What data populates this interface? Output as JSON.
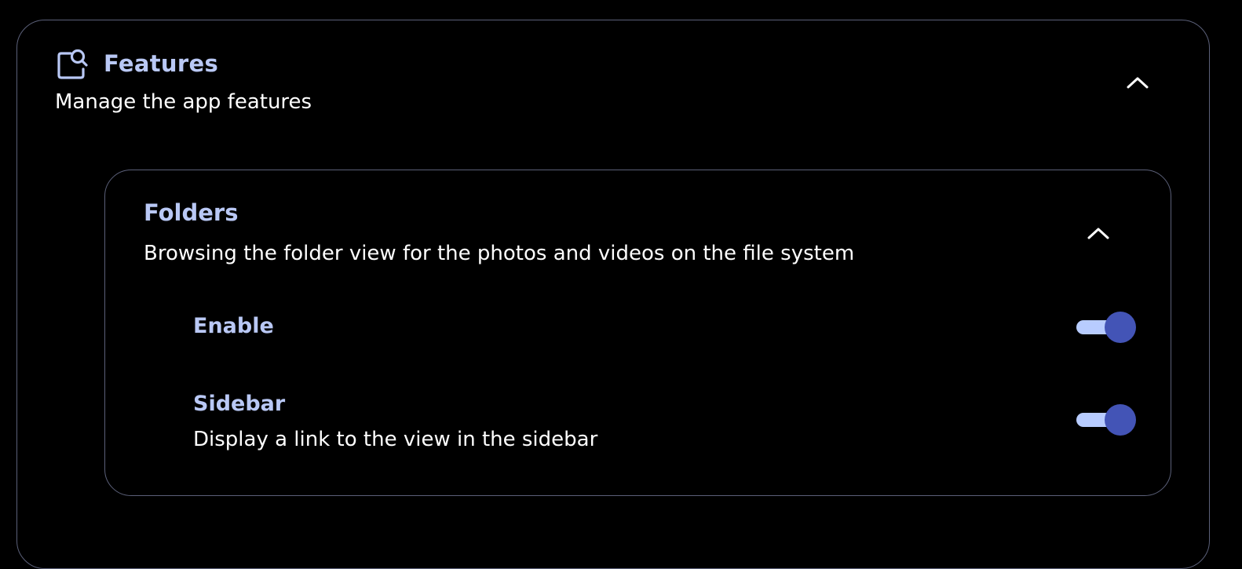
{
  "features": {
    "title": "Features",
    "description": "Manage the app features",
    "icon": "folder-search-icon",
    "expanded": true
  },
  "folders": {
    "title": "Folders",
    "description": "Browsing the folder view for the photos and videos on the file system",
    "expanded": true,
    "settings": [
      {
        "label": "Enable",
        "enabled": true
      },
      {
        "label": "Sidebar",
        "description": "Display a link to the view in the sidebar",
        "enabled": true
      }
    ]
  },
  "colors": {
    "background": "#000000",
    "heading": "#b9c8f5",
    "text": "#ffffff",
    "border": "#5b6079",
    "toggle_track": "#b8ccff",
    "toggle_knob": "#4354b6"
  }
}
